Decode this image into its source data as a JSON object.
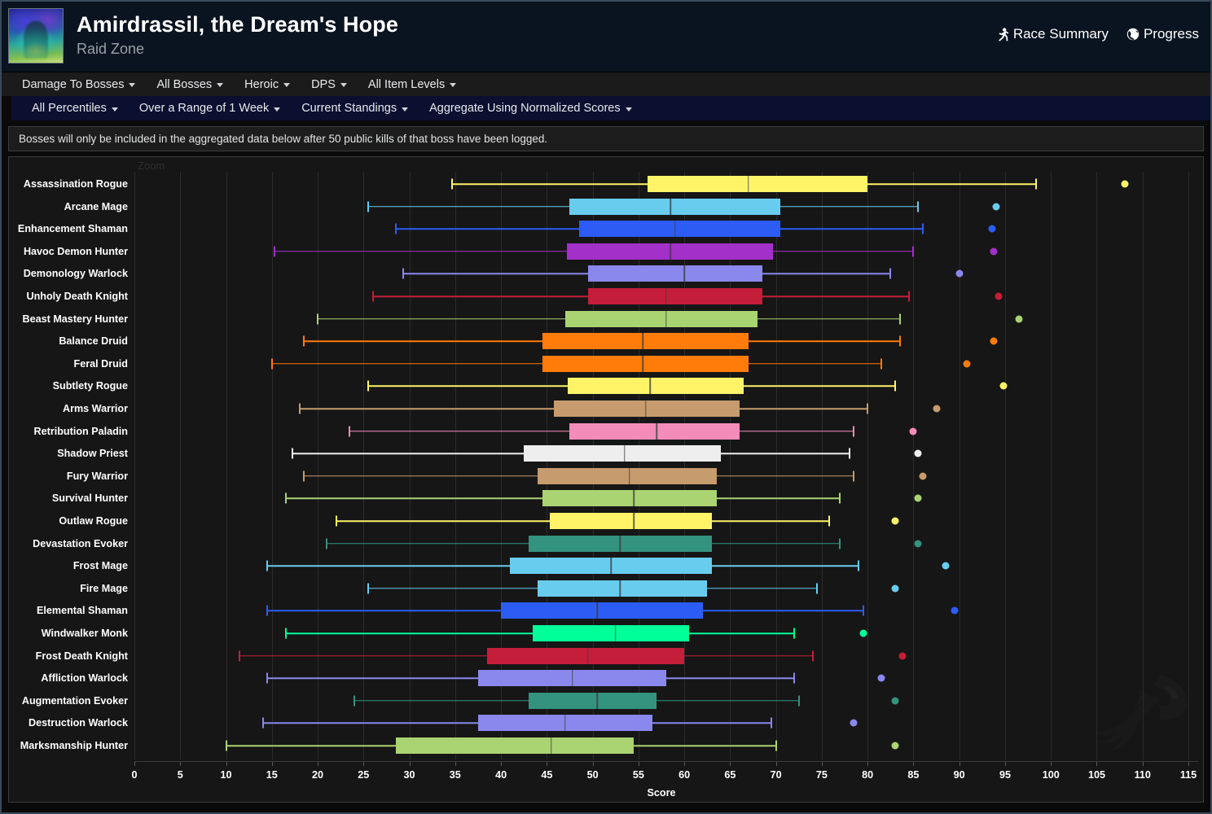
{
  "header": {
    "title": "Amirdrassil, the Dream's Hope",
    "subtitle": "Raid Zone",
    "zone_icon_name": "raid-zone-thumbnail",
    "links": [
      {
        "label": "Race Summary",
        "icon": "running-person-icon"
      },
      {
        "label": "Progress",
        "icon": "globe-icon"
      }
    ]
  },
  "nav_primary": [
    {
      "label": "Damage To Bosses",
      "caret": true
    },
    {
      "label": "All Bosses",
      "caret": true
    },
    {
      "label": "Heroic",
      "caret": true
    },
    {
      "label": "DPS",
      "caret": true
    },
    {
      "label": "All Item Levels",
      "caret": true
    }
  ],
  "nav_secondary": [
    {
      "label": "All Percentiles",
      "caret": true
    },
    {
      "label": "Over a Range of 1 Week",
      "caret": true
    },
    {
      "label": "Current Standings",
      "caret": true
    },
    {
      "label": "Aggregate Using Normalized Scores",
      "caret": true
    }
  ],
  "notice": "Bosses will only be included in the aggregated data below after 50 public kills of that boss have been logged.",
  "chart_controls": {
    "zoom_label": "Zoom"
  },
  "colors": {
    "page_background": "#0a0a0a",
    "header_background": "#0a1420",
    "nav_primary_background": "#1b1b1b",
    "nav_secondary_background": "#0b0f30",
    "panel_background": "#161616",
    "gridline": "#2b2b2b",
    "text": "#ffffff"
  },
  "chart_data": {
    "type": "box",
    "title": "",
    "xlabel": "Score",
    "ylabel": "",
    "xlim": [
      0,
      115
    ],
    "xticks": [
      0,
      5,
      10,
      15,
      20,
      25,
      30,
      35,
      40,
      45,
      50,
      55,
      60,
      65,
      70,
      75,
      80,
      85,
      90,
      95,
      100,
      105,
      110,
      115
    ],
    "grid": true,
    "legend": "none",
    "categories": [
      "Assassination Rogue",
      "Arcane Mage",
      "Enhancement Shaman",
      "Havoc Demon Hunter",
      "Demonology Warlock",
      "Unholy Death Knight",
      "Beast Mastery Hunter",
      "Balance Druid",
      "Feral Druid",
      "Subtlety Rogue",
      "Arms Warrior",
      "Retribution Paladin",
      "Shadow Priest",
      "Fury Warrior",
      "Survival Hunter",
      "Outlaw Rogue",
      "Devastation Evoker",
      "Frost Mage",
      "Fire Mage",
      "Elemental Shaman",
      "Windwalker Monk",
      "Frost Death Knight",
      "Affliction Warlock",
      "Augmentation Evoker",
      "Destruction Warlock",
      "Marksmanship Hunter"
    ],
    "boxes": [
      {
        "name": "Assassination Rogue",
        "color": "#FFF468",
        "low": 34.7,
        "q1": 56.0,
        "median": 67.0,
        "q3": 80.0,
        "high": 98.4,
        "outlier": 108.1
      },
      {
        "name": "Arcane Mage",
        "color": "#68CCEF",
        "low": 25.5,
        "q1": 47.5,
        "median": 58.5,
        "q3": 70.5,
        "high": 85.5,
        "outlier": 94.0
      },
      {
        "name": "Enhancement Shaman",
        "color": "#2D5CF5",
        "low": 28.5,
        "q1": 48.5,
        "median": 59.0,
        "q3": 70.5,
        "high": 86.0,
        "outlier": 93.6
      },
      {
        "name": "Havoc Demon Hunter",
        "color": "#A330C9",
        "low": 15.3,
        "q1": 47.2,
        "median": 58.5,
        "q3": 69.7,
        "high": 85.0,
        "outlier": 93.8
      },
      {
        "name": "Demonology Warlock",
        "color": "#8A87ED",
        "low": 29.3,
        "q1": 49.5,
        "median": 60.0,
        "q3": 68.5,
        "high": 82.5,
        "outlier": 90.0
      },
      {
        "name": "Unholy Death Knight",
        "color": "#C41E3A",
        "low": 26.0,
        "q1": 49.5,
        "median": 58.0,
        "q3": 68.5,
        "high": 84.5,
        "outlier": 94.3
      },
      {
        "name": "Beast Mastery Hunter",
        "color": "#AAD372",
        "low": 20.0,
        "q1": 47.0,
        "median": 58.0,
        "q3": 68.0,
        "high": 83.5,
        "outlier": 96.5
      },
      {
        "name": "Balance Druid",
        "color": "#FF7C0A",
        "low": 18.5,
        "q1": 44.5,
        "median": 55.5,
        "q3": 67.0,
        "high": 83.5,
        "outlier": 93.8
      },
      {
        "name": "Feral Druid",
        "color": "#FF7C0A",
        "low": 15.0,
        "q1": 44.5,
        "median": 55.5,
        "q3": 67.0,
        "high": 81.5,
        "outlier": 90.8
      },
      {
        "name": "Subtlety Rogue",
        "color": "#FFF468",
        "low": 25.5,
        "q1": 47.3,
        "median": 56.3,
        "q3": 66.5,
        "high": 83.0,
        "outlier": 94.8
      },
      {
        "name": "Arms Warrior",
        "color": "#C69B6D",
        "low": 18.0,
        "q1": 45.8,
        "median": 55.8,
        "q3": 66.0,
        "high": 80.0,
        "outlier": 87.5
      },
      {
        "name": "Retribution Paladin",
        "color": "#F48CBA",
        "low": 23.5,
        "q1": 47.5,
        "median": 57.0,
        "q3": 66.0,
        "high": 78.5,
        "outlier": 85.0
      },
      {
        "name": "Shadow Priest",
        "color": "#EEEEEE",
        "low": 17.2,
        "q1": 42.5,
        "median": 53.5,
        "q3": 64.0,
        "high": 78.0,
        "outlier": 85.5
      },
      {
        "name": "Fury Warrior",
        "color": "#C69B6D",
        "low": 18.5,
        "q1": 44.0,
        "median": 54.0,
        "q3": 63.5,
        "high": 78.5,
        "outlier": 86.0
      },
      {
        "name": "Survival Hunter",
        "color": "#AAD372",
        "low": 16.5,
        "q1": 44.5,
        "median": 54.5,
        "q3": 63.5,
        "high": 77.0,
        "outlier": 85.5
      },
      {
        "name": "Outlaw Rogue",
        "color": "#FFF468",
        "low": 22.0,
        "q1": 45.3,
        "median": 54.5,
        "q3": 63.0,
        "high": 75.8,
        "outlier": 83.0
      },
      {
        "name": "Devastation Evoker",
        "color": "#33937F",
        "low": 21.0,
        "q1": 43.0,
        "median": 53.0,
        "q3": 63.0,
        "high": 77.0,
        "outlier": 85.5
      },
      {
        "name": "Frost Mage",
        "color": "#68CCEF",
        "low": 14.5,
        "q1": 41.0,
        "median": 52.0,
        "q3": 63.0,
        "high": 79.0,
        "outlier": 88.5
      },
      {
        "name": "Fire Mage",
        "color": "#68CCEF",
        "low": 25.5,
        "q1": 44.0,
        "median": 53.0,
        "q3": 62.5,
        "high": 74.5,
        "outlier": 83.0
      },
      {
        "name": "Elemental Shaman",
        "color": "#2D5CF5",
        "low": 14.5,
        "q1": 40.0,
        "median": 50.5,
        "q3": 62.0,
        "high": 79.5,
        "outlier": 89.5
      },
      {
        "name": "Windwalker Monk",
        "color": "#00FF98",
        "low": 16.5,
        "q1": 43.5,
        "median": 52.5,
        "q3": 60.5,
        "high": 72.0,
        "outlier": 79.5
      },
      {
        "name": "Frost Death Knight",
        "color": "#C41E3A",
        "low": 11.5,
        "q1": 38.5,
        "median": 49.5,
        "q3": 60.0,
        "high": 74.0,
        "outlier": 83.8
      },
      {
        "name": "Affliction Warlock",
        "color": "#8A87ED",
        "low": 14.5,
        "q1": 37.5,
        "median": 47.8,
        "q3": 58.0,
        "high": 72.0,
        "outlier": 81.5
      },
      {
        "name": "Augmentation Evoker",
        "color": "#33937F",
        "low": 24.0,
        "q1": 43.0,
        "median": 50.5,
        "q3": 57.0,
        "high": 72.5,
        "outlier": 83.0
      },
      {
        "name": "Destruction Warlock",
        "color": "#8A87ED",
        "low": 14.0,
        "q1": 37.5,
        "median": 47.0,
        "q3": 56.5,
        "high": 69.5,
        "outlier": 78.5
      },
      {
        "name": "Marksmanship Hunter",
        "color": "#AAD372",
        "low": 10.0,
        "q1": 28.5,
        "median": 45.5,
        "q3": 54.5,
        "high": 70.0,
        "outlier": 83.0
      }
    ]
  }
}
